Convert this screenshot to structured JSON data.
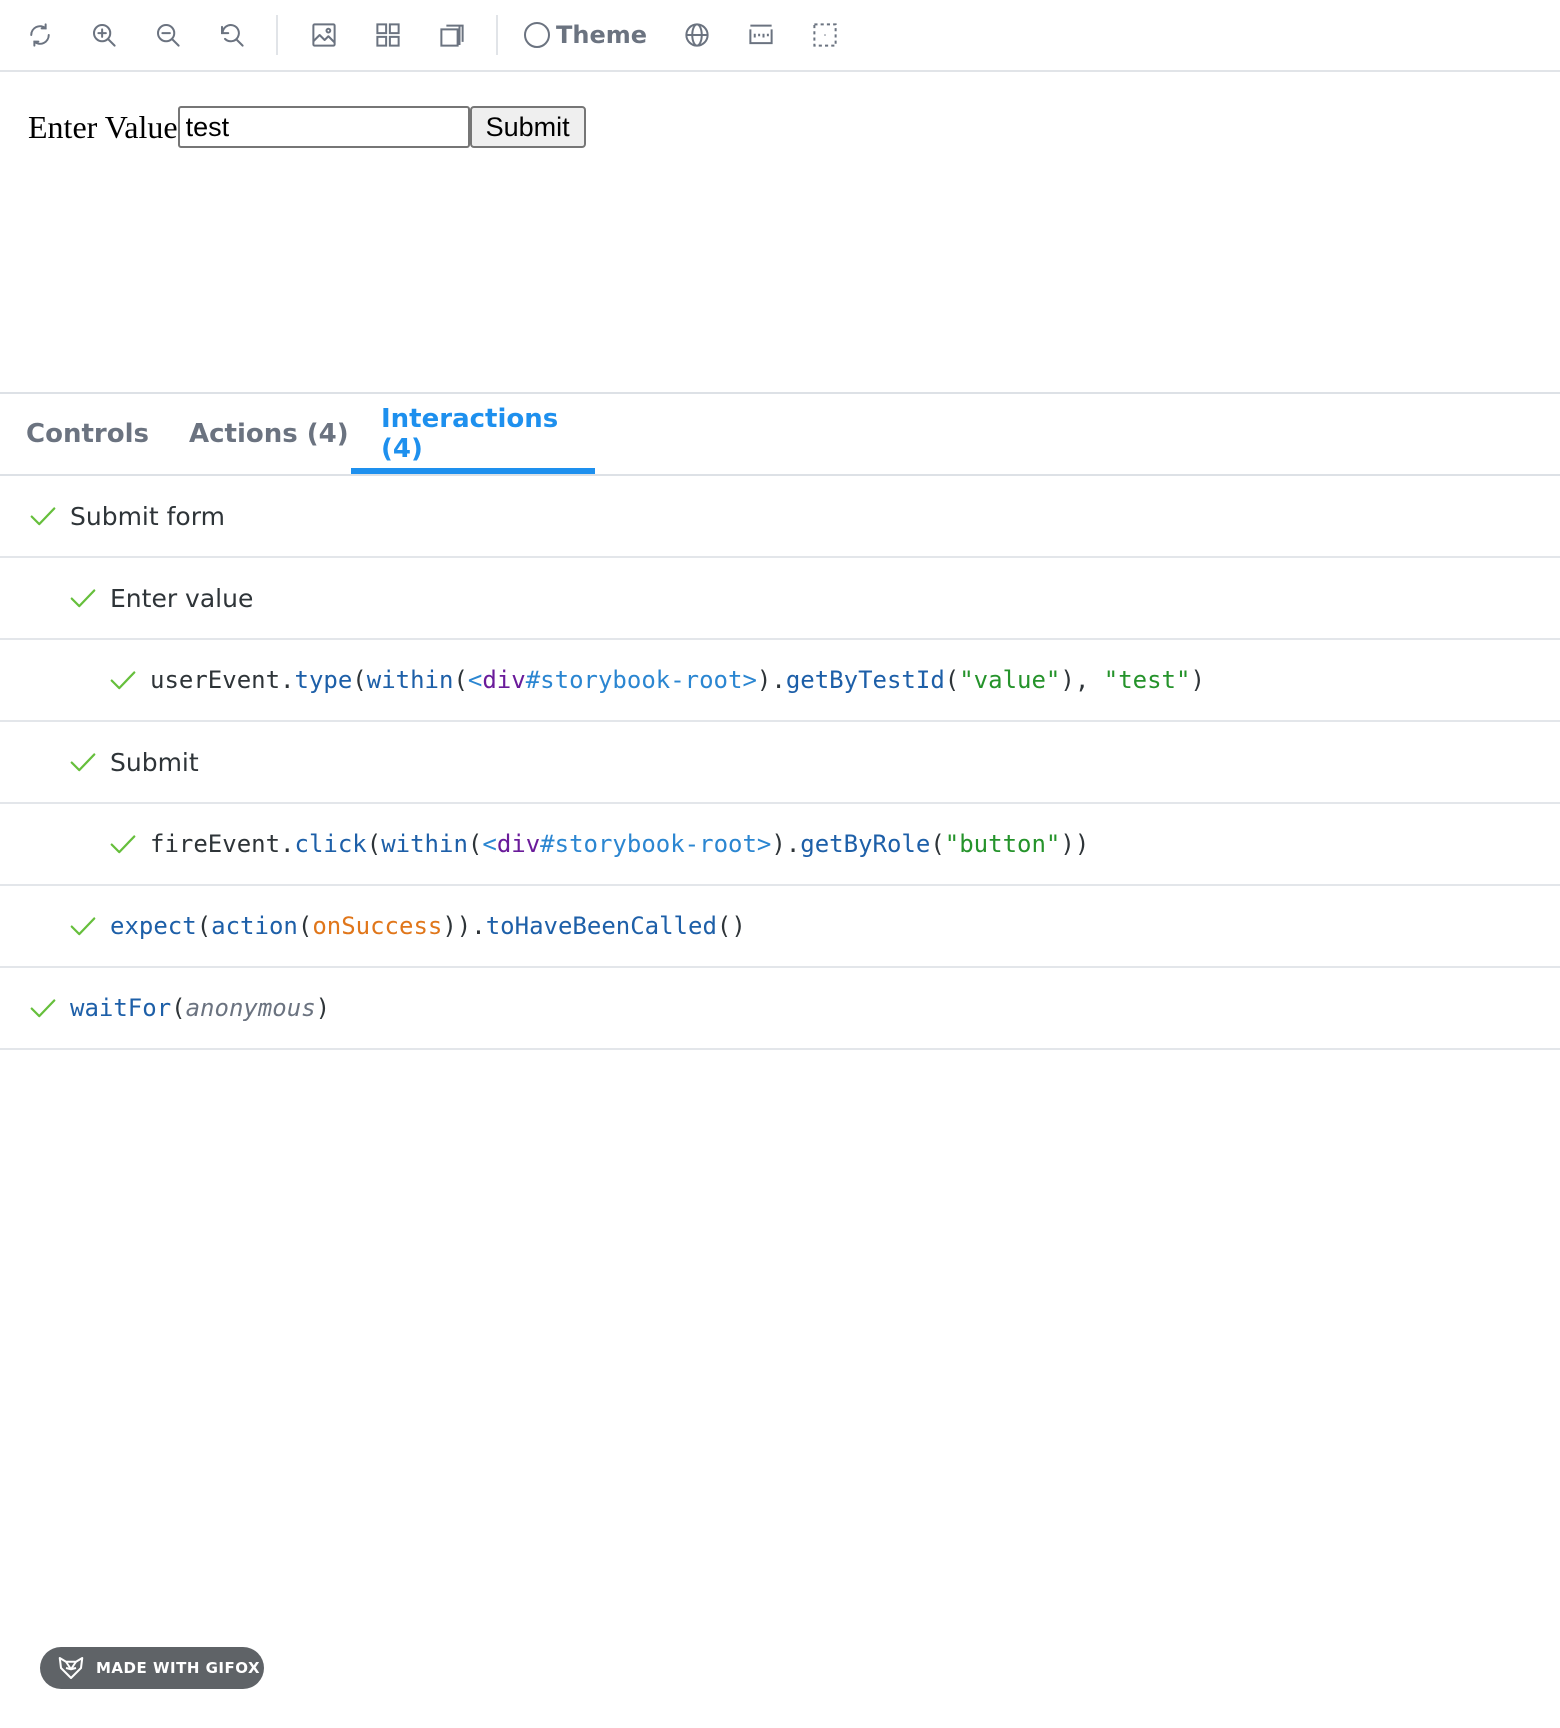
{
  "toolbar": {
    "buttons": [
      "reload-icon",
      "zoom-in-icon",
      "zoom-out-icon",
      "reset-zoom-icon",
      "background-icon",
      "grid-icon",
      "viewport-icon",
      "globe-icon",
      "measure-icon",
      "outline-icon"
    ],
    "theme_label": "Theme"
  },
  "preview": {
    "label": "Enter Value",
    "input_value": "test",
    "submit_label": "Submit"
  },
  "tabs": [
    {
      "label": "Controls",
      "active": false
    },
    {
      "label": "Actions (4)",
      "active": false
    },
    {
      "label": "Interactions (4)",
      "active": true
    }
  ],
  "interactions": {
    "submit_form": "Submit form",
    "enter_value": "Enter value",
    "type_call": {
      "obj": "userEvent.",
      "fn": "type",
      "p1": "(",
      "within": "within",
      "p2": "(",
      "el_open": "<",
      "el": "div",
      "sel": "#storybook-root",
      "el_close": ">",
      "p3": ").",
      "getter": "getByTestId",
      "p4": "(",
      "arg1": "\"value\"",
      "p5": "), ",
      "arg2": "\"test\"",
      "p6": ")"
    },
    "submit": "Submit",
    "click_call": {
      "obj": "fireEvent.",
      "fn": "click",
      "p1": "(",
      "within": "within",
      "p2": "(",
      "el_open": "<",
      "el": "div",
      "sel": "#storybook-root",
      "el_close": ">",
      "p3": ").",
      "getter": "getByRole",
      "p4": "(",
      "arg1": "\"button\"",
      "p5": "))"
    },
    "expect_call": {
      "fn": "expect",
      "p1": "(",
      "action": "action",
      "p2": "(",
      "var": "onSuccess",
      "p3": ")).",
      "matcher": "toHaveBeenCalled",
      "p4": "()"
    },
    "waitfor_call": {
      "fn": "waitFor",
      "p1": "(",
      "arg": "anonymous",
      "p2": ")"
    }
  },
  "colors": {
    "accent": "#1e90ee",
    "check": "#66bf3c",
    "muted": "#6b7380"
  },
  "badge": {
    "text": "MADE WITH GIFOX"
  }
}
